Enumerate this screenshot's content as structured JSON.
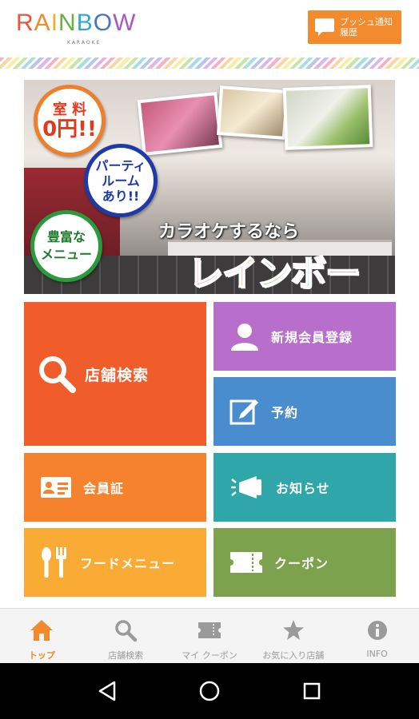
{
  "header": {
    "logo_letters": [
      "R",
      "A",
      "I",
      "N",
      "B",
      "O",
      "W"
    ],
    "logo_colors": [
      "#e8553b",
      "#f08a2a",
      "#e9b22a",
      "#66b040",
      "#33a9c9",
      "#4a72c9",
      "#a55bc0"
    ],
    "logo_sub": "KARAOKE",
    "push_button_label_line1": "プッシュ通知",
    "push_button_label_line2": "履歴"
  },
  "banner": {
    "badge_free_line1": "室 料",
    "badge_free_line2": "0円!!",
    "badge_party_line1": "パーティ",
    "badge_party_line2": "ルーム",
    "badge_party_line3": "あり!!",
    "badge_menu_line1": "豊富な",
    "badge_menu_line2": "メニュー",
    "tagline": "カラオケするなら",
    "brand_name_chars": [
      "レ",
      "イ",
      "ン",
      "ボ",
      "ー"
    ],
    "brand_name_colors": [
      "#e8407a",
      "#f08a2a",
      "#66b040",
      "#33a9c9",
      "#8b4fc4"
    ]
  },
  "tiles": {
    "store_search": "店舗検索",
    "new_member": "新規会員登録",
    "reservation": "予約",
    "member_card": "会員証",
    "news": "お知らせ",
    "food_menu": "フードメニュー",
    "coupon": "クーポン"
  },
  "tabbar": {
    "items": [
      {
        "label": "トップ",
        "icon": "home-icon",
        "active": true
      },
      {
        "label": "店舗検索",
        "icon": "search-icon",
        "active": false
      },
      {
        "label": "マイ クーポン",
        "icon": "ticket-icon",
        "active": false
      },
      {
        "label": "お気に入り店舗",
        "icon": "star-icon",
        "active": false
      },
      {
        "label": "INFO",
        "icon": "info-icon",
        "active": false
      }
    ],
    "active_color": "#f08a2a",
    "inactive_color": "#9a9a9a"
  },
  "colors": {
    "search_tile": "#f05c2a",
    "register_tile": "#b86fcc",
    "reserve_tile": "#4a8dcf",
    "card_tile": "#f7822e",
    "news_tile": "#2fa6a9",
    "food_tile": "#f9ab36",
    "coupon_tile": "#7da24d",
    "push_button": "#f28a2a"
  }
}
